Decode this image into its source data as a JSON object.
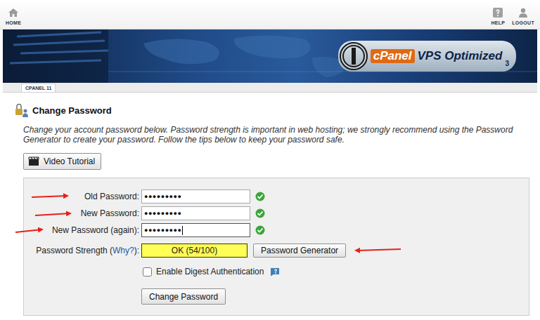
{
  "toolbar": {
    "home": "HOME",
    "help": "HELP",
    "logout": "LOGOUT"
  },
  "banner": {
    "brand": "cPanel",
    "product": "VPS Optimized",
    "version": "3"
  },
  "tab": "CPANEL 11",
  "section": {
    "title": "Change Password",
    "description": "Change your account password below. Password strength is important in web hosting; we strongly recommend using the Password Generator to create your password. Follow the tips below to keep your password safe."
  },
  "video_button": "Video Tutorial",
  "fields": [
    {
      "label": "Old Password:",
      "value": "●●●●●●●●●",
      "valid": true,
      "focused": false
    },
    {
      "label": "New Password:",
      "value": "●●●●●●●●●",
      "valid": true,
      "focused": false
    },
    {
      "label": "New Password (again):",
      "value": "●●●●●●●●●",
      "valid": true,
      "focused": true
    }
  ],
  "strength": {
    "label_prefix": "Password Strength (",
    "link": "Why?",
    "label_suffix": "):",
    "reading": "OK (54/100)",
    "generator_button": "Password Generator"
  },
  "digest": {
    "label": "Enable Digest Authentication",
    "checked": false
  },
  "submit_button": "Change Password"
}
